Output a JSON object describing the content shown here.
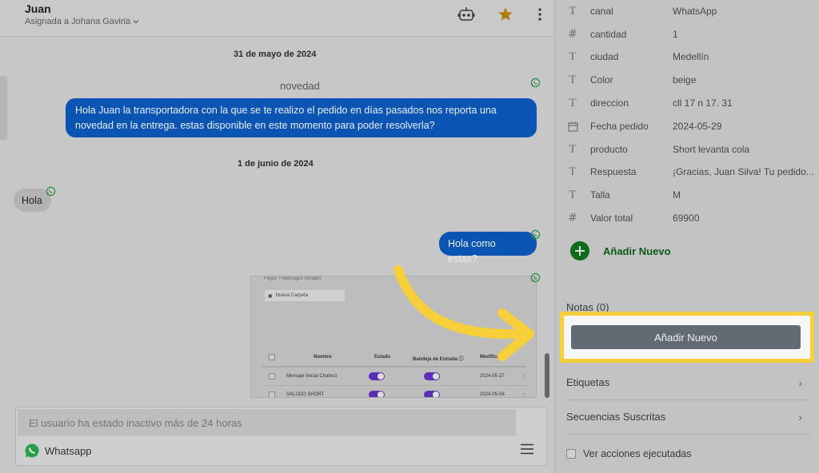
{
  "header": {
    "contact_name": "Juan",
    "assigned_to": "Asignada a Johana Gaviria"
  },
  "messages": {
    "date_1": "31 de mayo de 2024",
    "template_name": "novedad",
    "msg_1": "Hola Juan la transportadora con la que se te realizo el pedido en días pasados nos reporta una novedad en la entrega. estas disponible en este momento para poder resolverla?",
    "date_2": "1 de junio de 2024",
    "msg_2": "Hola",
    "msg_3": "Hola como estas?"
  },
  "preview": {
    "breadcrumb": "Flujos > Mensajes Iniciales",
    "folder_button": "Nueva Carpeta",
    "columns": [
      "Nombre",
      "Estado",
      "Bandeja de Entrada ⓘ",
      "Modifica"
    ],
    "rows": [
      {
        "name": "Mensaje Inicial Chaleco",
        "date": "2024-05-27"
      },
      {
        "name": "SALUDO SHORT",
        "date": "2024-05-06"
      }
    ]
  },
  "composer": {
    "placeholder": "El usuario ha estado inactivo más de 24 horas",
    "channel": "Whatsapp"
  },
  "fields": [
    {
      "icon": "text",
      "label": "canal",
      "value": "WhatsApp"
    },
    {
      "icon": "number",
      "label": "cantidad",
      "value": "1"
    },
    {
      "icon": "text",
      "label": "ciudad",
      "value": "Medellín"
    },
    {
      "icon": "text",
      "label": "Color",
      "value": "beige"
    },
    {
      "icon": "text",
      "label": "direccion",
      "value": "cll 17 n 17. 31"
    },
    {
      "icon": "calendar",
      "label": "Fecha pedido",
      "value": "2024-05-29"
    },
    {
      "icon": "text",
      "label": "producto",
      "value": "Short levanta cola"
    },
    {
      "icon": "text",
      "label": "Respuesta",
      "value": "¡Gracias, Juan Silva! Tu pedido..."
    },
    {
      "icon": "text",
      "label": "Talla",
      "value": "M"
    },
    {
      "icon": "number",
      "label": "Valor total",
      "value": "69900"
    }
  ],
  "details": {
    "add_field": "Añadir Nuevo",
    "notes_label": "Notas (0)",
    "add_note": "Añadir Nuevo",
    "tags": "Etiquetas",
    "sequences": "Secuencias Suscritas",
    "executed_actions": "Ver acciones ejecutadas"
  },
  "colors": {
    "accent_blue": "#0a55b4",
    "highlight_yellow": "#f6cf3a",
    "whatsapp_green": "#2a9d48"
  }
}
